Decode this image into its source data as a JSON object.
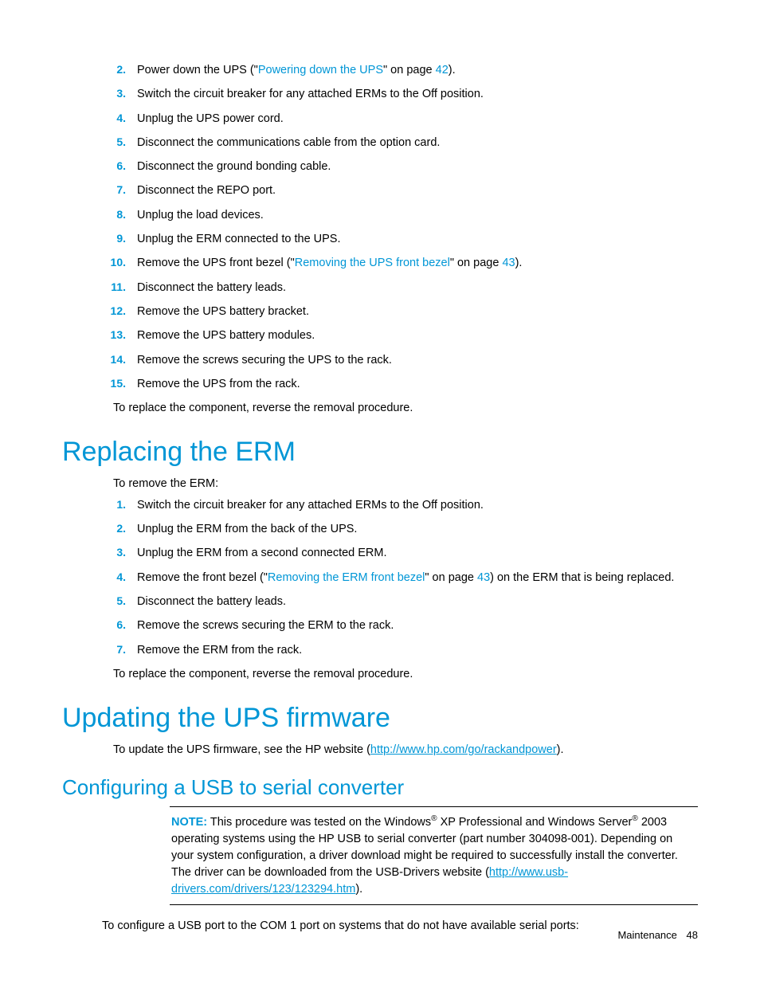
{
  "list1": {
    "start": 2,
    "items": [
      {
        "pre": "Power down the UPS (\"",
        "link": "Powering down the UPS",
        "mid": "\" on page ",
        "page": "42",
        "post": ")."
      },
      {
        "text": "Switch the circuit breaker for any attached ERMs to the Off position."
      },
      {
        "text": "Unplug the UPS power cord."
      },
      {
        "text": "Disconnect the communications cable from the option card."
      },
      {
        "text": "Disconnect the ground bonding cable."
      },
      {
        "text": "Disconnect the REPO port."
      },
      {
        "text": "Unplug the load devices."
      },
      {
        "text": "Unplug the ERM connected to the UPS."
      },
      {
        "pre": "Remove the UPS front bezel (\"",
        "link": "Removing the UPS front bezel",
        "mid": "\" on page ",
        "page": "43",
        "post": ")."
      },
      {
        "text": "Disconnect the battery leads."
      },
      {
        "text": "Remove the UPS battery bracket."
      },
      {
        "text": "Remove the UPS battery modules."
      },
      {
        "text": "Remove the screws securing the UPS to the rack."
      },
      {
        "text": "Remove the UPS from the rack."
      }
    ],
    "after": "To replace the component, reverse the removal procedure."
  },
  "section_erm": {
    "title": "Replacing the ERM",
    "intro": "To remove the ERM:",
    "items": [
      {
        "text": "Switch the circuit breaker for any attached ERMs to the Off position."
      },
      {
        "text": "Unplug the ERM from the back of the UPS."
      },
      {
        "text": "Unplug the ERM from a second connected ERM."
      },
      {
        "pre": "Remove the front bezel (\"",
        "link": "Removing the ERM front bezel",
        "mid": "\" on page ",
        "page": "43",
        "post": ") on the ERM that is being replaced."
      },
      {
        "text": "Disconnect the battery leads."
      },
      {
        "text": "Remove the screws securing the ERM to the rack."
      },
      {
        "text": "Remove the ERM from the rack."
      }
    ],
    "after": "To replace the component, reverse the removal procedure."
  },
  "section_fw": {
    "title": "Updating the UPS firmware",
    "intro_pre": "To update the UPS firmware, see the HP website (",
    "intro_link": "http://www.hp.com/go/rackandpower",
    "intro_post": ")."
  },
  "section_usb": {
    "title": "Configuring a USB to serial converter",
    "note_label": "NOTE:",
    "note_p1a": "  This procedure was tested on the Windows",
    "note_p1b": " XP Professional and Windows Server",
    "note_p2": " 2003 operating systems using the HP USB to serial converter (part number 304098-001). Depending on your system configuration, a driver download might be required to successfully install the converter. The driver can be downloaded from the USB-Drivers website (",
    "note_link": "http://www.usb-drivers.com/drivers/123/123294.htm",
    "note_post": ").",
    "body": "To configure a USB port to the COM 1 port on systems that do not have available serial ports:"
  },
  "footer": {
    "section": "Maintenance",
    "page": "48"
  }
}
